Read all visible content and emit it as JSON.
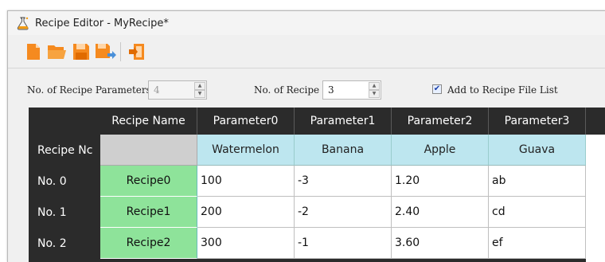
{
  "window": {
    "title": "Recipe Editor - MyRecipe*"
  },
  "toolbar": {
    "buttons": [
      {
        "name": "new-file-icon"
      },
      {
        "name": "open-folder-icon"
      },
      {
        "name": "save-icon"
      },
      {
        "name": "save-as-icon"
      },
      {
        "name": "export-icon"
      }
    ]
  },
  "params": {
    "num_params_label": "No. of Recipe Parameters",
    "num_params_value": "4",
    "num_recipe_label": "No. of Recipe",
    "num_recipe_value": "3",
    "add_to_list_label": "Add to Recipe File List",
    "add_to_list_checked": true
  },
  "table": {
    "corner_label": "Recipe Nc",
    "name_header": "Recipe Name",
    "columns": [
      "Parameter0",
      "Parameter1",
      "Parameter2",
      "Parameter3"
    ],
    "column_values": [
      "Watermelon",
      "Banana",
      "Apple",
      "Guava"
    ],
    "rows": [
      {
        "label": "No. 0",
        "name": "Recipe0",
        "cells": [
          "100",
          "-3",
          "1.20",
          "ab"
        ]
      },
      {
        "label": "No. 1",
        "name": "Recipe1",
        "cells": [
          "200",
          "-2",
          "2.40",
          "cd"
        ]
      },
      {
        "label": "No. 2",
        "name": "Recipe2",
        "cells": [
          "300",
          "-1",
          "3.60",
          "ef"
        ]
      }
    ]
  },
  "colors": {
    "accent": "#ff7a00",
    "grid_header_bg": "#2b2b2b",
    "fruit_row_bg": "#bde6ef",
    "recipe_name_bg": "#8ee39a"
  }
}
